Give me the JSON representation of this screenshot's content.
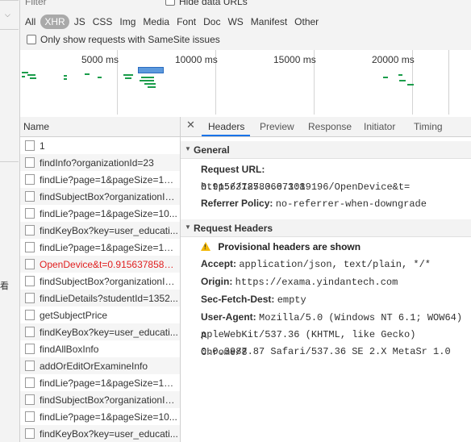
{
  "filter": {
    "placeholder": "Filter"
  },
  "hide_data_urls": {
    "label": "Hide data URLs"
  },
  "type_filters": [
    "All",
    "XHR",
    "JS",
    "CSS",
    "Img",
    "Media",
    "Font",
    "Doc",
    "WS",
    "Manifest",
    "Other"
  ],
  "active_type": "XHR",
  "samesite": {
    "label": "Only show requests with SameSite issues"
  },
  "overview": {
    "ticks": [
      "5000 ms",
      "10000 ms",
      "15000 ms",
      "20000 ms"
    ]
  },
  "list": {
    "column_name": "Name",
    "requests": [
      "1",
      "findInfo?organizationId=23",
      "findLie?page=1&pageSize=1&...",
      "findSubjectBox?organizationId...",
      "findLie?page=1&pageSize=10...",
      "findKeyBox?key=user_educati...",
      "findLie?page=1&pageSize=1&...",
      "OpenDevice&t=0.91563785836...",
      "findSubjectBox?organizationId...",
      "findLieDetails?studentId=1352...",
      "getSubjectPrice",
      "findKeyBox?key=user_educati...",
      "findAllBoxInfo",
      "addOrEditOrExamineInfo",
      "findLie?page=1&pageSize=1&...",
      "findSubjectBox?organizationId...",
      "findLie?page=1&pageSize=10...",
      "findKeyBox?key=user_educati..."
    ],
    "error_index": 7
  },
  "detail_tabs": [
    "Headers",
    "Preview",
    "Response",
    "Initiator",
    "Timing"
  ],
  "active_detail_tab": "Headers",
  "general": {
    "title": "General",
    "request_url_key": "Request URL:",
    "request_url_value_1": "http://127.0.0.1:19196/OpenDevice&t=",
    "request_url_value_2": "0.9156378583667308",
    "referrer_policy_key": "Referrer Policy:",
    "referrer_policy_value": "no-referrer-when-downgrade"
  },
  "request_headers": {
    "title": "Request Headers",
    "warning": "Provisional headers are shown",
    "accept_key": "Accept:",
    "accept_value": "application/json, text/plain, */*",
    "origin_key": "Origin:",
    "origin_value": "https://exama.yindantech.com",
    "sec_fetch_dest_key": "Sec-Fetch-Dest:",
    "sec_fetch_dest_value": "empty",
    "user_agent_key": "User-Agent:",
    "user_agent_value_1": "Mozilla/5.0 (Windows NT 6.1; WOW64) A",
    "user_agent_value_2": "ppleWebKit/537.36 (KHTML, like Gecko) Chrome/8",
    "user_agent_value_3": "0.0.3987.87 Safari/537.36 SE 2.X MetaSr 1.0"
  },
  "left_panel": {
    "glyph": "看"
  },
  "colors": {
    "error": "#e02020",
    "accent": "#1a73e8",
    "bar_green": "#1b9d4b",
    "warning": "#f2b705"
  }
}
